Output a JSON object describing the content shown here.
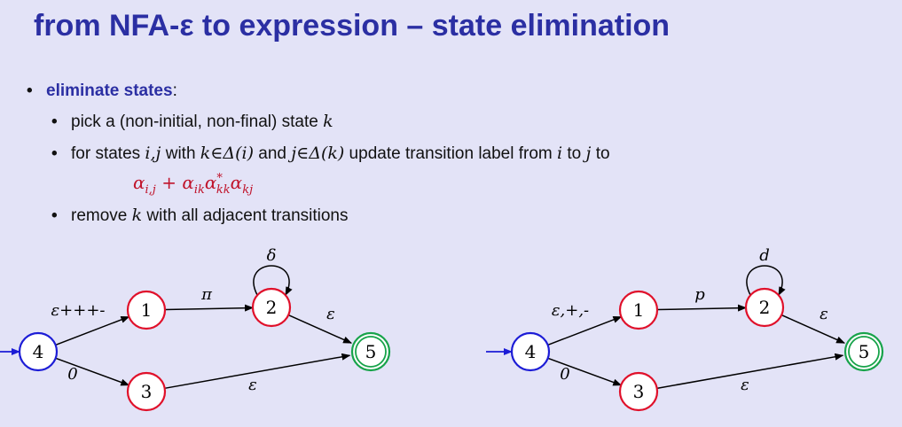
{
  "title": "from NFA-ε to expression – state elimination",
  "bullet_main": {
    "marker": "•",
    "label": "eliminate states",
    "suffix": ":"
  },
  "sub_bullets": [
    {
      "marker": "•",
      "parts": [
        {
          "t": "pick a (non-initial, non-final) state ",
          "m": false
        },
        {
          "t": "k",
          "m": true
        }
      ]
    },
    {
      "marker": "•",
      "parts": [
        {
          "t": "for states ",
          "m": false
        },
        {
          "t": "i,j",
          "m": true
        },
        {
          "t": " with ",
          "m": false
        },
        {
          "t": "k∈Δ(i)",
          "m": true
        },
        {
          "t": " and ",
          "m": false
        },
        {
          "t": "j∈Δ(k)",
          "m": true
        },
        {
          "t": " update transition label from ",
          "m": false
        },
        {
          "t": "i",
          "m": true
        },
        {
          "t": " to ",
          "m": false
        },
        {
          "t": "j",
          "m": true
        },
        {
          "t": " to",
          "m": false
        }
      ]
    },
    {
      "marker": "•",
      "parts": [
        {
          "t": "remove ",
          "m": false
        },
        {
          "t": "k",
          "m": true
        },
        {
          "t": " with all adjacent transitions",
          "m": false
        }
      ]
    }
  ],
  "formula": {
    "a1": "α",
    "s1": "i,j",
    "plus": " + ",
    "a2": "α",
    "s2": "ik",
    "a3": "α",
    "s3": "kk",
    "sup3": "*",
    "a4": "α",
    "s4": "kj"
  },
  "diagrams": [
    {
      "states": [
        "4",
        "1",
        "3",
        "2",
        "5"
      ],
      "labels": {
        "e41": "ε+++-",
        "e43": "0",
        "e12": "π",
        "loop2": "δ",
        "e25": "ε",
        "e35": "ε"
      }
    },
    {
      "states": [
        "4",
        "1",
        "3",
        "2",
        "5"
      ],
      "labels": {
        "e41": "ε,+,-",
        "e43": "0",
        "e12": "p",
        "loop2": "d",
        "e25": "ε",
        "e35": "ε"
      }
    }
  ],
  "colors": {
    "initial_state": "#1c1cd6",
    "state": "#e0102a",
    "final_state": "#17a34a",
    "start_arrow": "#1c1cd6",
    "title": "#2b2fa3",
    "formula": "#c0142b"
  }
}
